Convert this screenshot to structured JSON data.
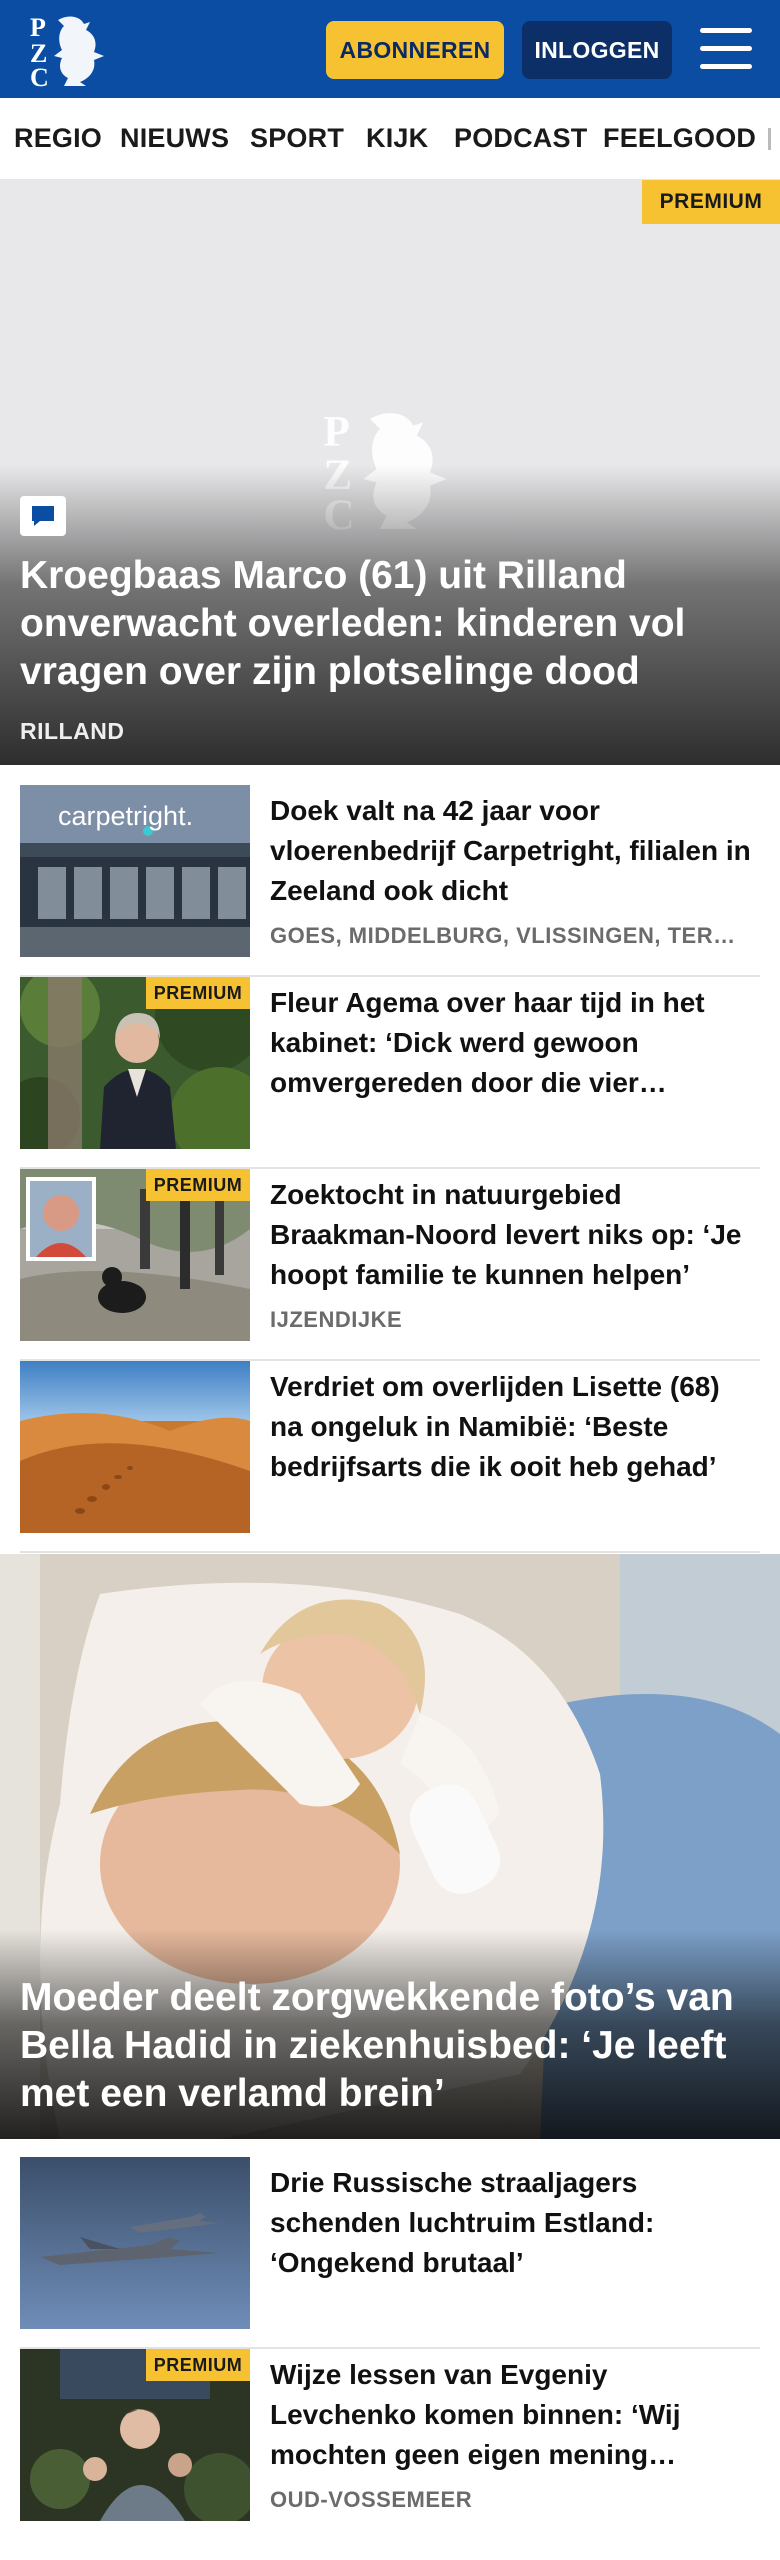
{
  "header": {
    "logo_text": "PZC",
    "subscribe_label": "ABONNEREN",
    "login_label": "INLOGGEN",
    "menu_icon": "hamburger-menu-icon",
    "brand_color": "#0a4da2",
    "accent_color": "#f6c232"
  },
  "nav": {
    "items": [
      "REGIO",
      "NIEUWS",
      "SPORT",
      "KIJK",
      "PODCAST",
      "FEELGOOD"
    ]
  },
  "hero": {
    "premium_label": "PREMIUM",
    "comment_icon": "comment-icon",
    "title": "Kroegbaas Marco (61) uit Rilland onverwacht overleden: kinderen vol vragen over zijn plotselinge dood",
    "location": "RILLAND"
  },
  "articles": [
    {
      "title": "Doek valt na 42 jaar voor vloerenbedrijf Carpetright, filialen in Zeeland ook dicht",
      "location": "GOES, MIDDELBURG, VLISSINGEN, TERNEUZEN",
      "premium": false,
      "thumb_text": "carpetright."
    },
    {
      "title": "Fleur Agema over haar tijd in het kabinet: ‘Dick werd gewoon omvergereden door die vier kemphanen’",
      "location": "",
      "premium": true,
      "premium_label": "PREMIUM"
    },
    {
      "title": "Zoektocht in natuurgebied Braakman-Noord levert niks op: ‘Je hoopt familie te kunnen helpen’",
      "location": "IJZENDIJKE",
      "premium": true,
      "premium_label": "PREMIUM"
    },
    {
      "title": "Verdriet om overlijden Lisette (68) na ongeluk in Namibië: ‘Beste bedrijfsarts die ik ooit heb gehad’",
      "location": "",
      "premium": false
    }
  ],
  "big_story": {
    "title": "Moeder deelt zorgwekkende foto’s van Bella Hadid in ziekenhuisbed: ‘Je leeft met een verlamd brein’"
  },
  "articles2": [
    {
      "title": "Drie Russische straaljagers schenden luchtruim Estland: ‘Ongekend brutaal’",
      "location": "",
      "premium": false
    },
    {
      "title": "Wijze lessen van Evgeniy Levchenko komen binnen: ‘Wij mochten geen eigen mening hebben’",
      "location": "OUD-VOSSEMEER",
      "premium": true,
      "premium_label": "PREMIUM"
    }
  ]
}
